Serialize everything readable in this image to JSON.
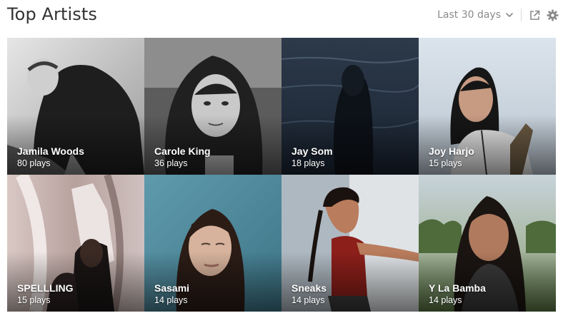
{
  "header": {
    "title": "Top Artists",
    "range_label": "Last 30 days",
    "icons": {
      "range": "chevron-down-icon",
      "share": "share-icon",
      "settings": "gear-icon"
    }
  },
  "artists": [
    {
      "name": "Jamila Woods",
      "plays": "80 plays"
    },
    {
      "name": "Carole King",
      "plays": "36 plays"
    },
    {
      "name": "Jay Som",
      "plays": "18 plays"
    },
    {
      "name": "Joy Harjo",
      "plays": "15 plays"
    },
    {
      "name": "SPELLLING",
      "plays": "15 plays"
    },
    {
      "name": "Sasami",
      "plays": "14 plays"
    },
    {
      "name": "Sneaks",
      "plays": "14 plays"
    },
    {
      "name": "Y La Bamba",
      "plays": "14 plays"
    }
  ],
  "colors": {
    "title": "#333333",
    "muted": "#8a8a8a"
  }
}
